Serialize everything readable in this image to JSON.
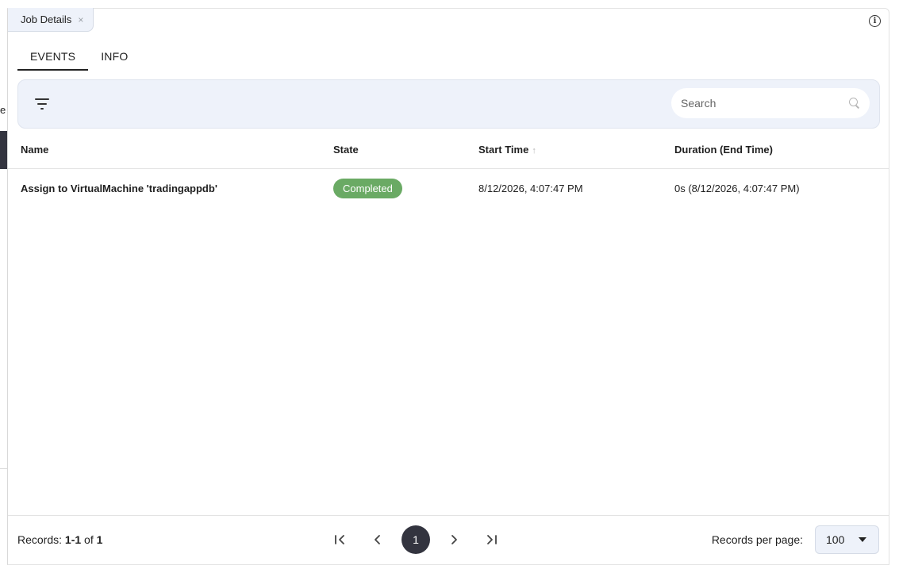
{
  "background": {
    "fragment_letter": "e"
  },
  "panel_tab": {
    "label": "Job Details",
    "close_glyph": "×"
  },
  "info_icon": {
    "glyph": "i"
  },
  "tabs": [
    {
      "label": "EVENTS",
      "active": true
    },
    {
      "label": "INFO",
      "active": false
    }
  ],
  "toolbar": {
    "search_placeholder": "Search"
  },
  "table": {
    "columns": [
      "Name",
      "State",
      "Start Time",
      "Duration (End Time)"
    ],
    "sort_indicator": "↑",
    "rows": [
      {
        "name": "Assign to VirtualMachine 'tradingappdb'",
        "state": "Completed",
        "start_time": "8/12/2026, 4:07:47 PM",
        "duration": "0s (8/12/2026, 4:07:47 PM)"
      }
    ]
  },
  "footer": {
    "records_prefix": "Records:",
    "records_range": "1-1",
    "records_of": "of",
    "records_total": "1",
    "current_page": "1",
    "pager_first": "|<",
    "pager_prev": "<",
    "pager_next": ">",
    "pager_last": ">|",
    "per_page_label": "Records per page:",
    "per_page_value": "100"
  },
  "colors": {
    "accent_dark": "#33343f",
    "toolbar_bg": "#eef2fa",
    "badge_completed": "#6aaa64"
  }
}
